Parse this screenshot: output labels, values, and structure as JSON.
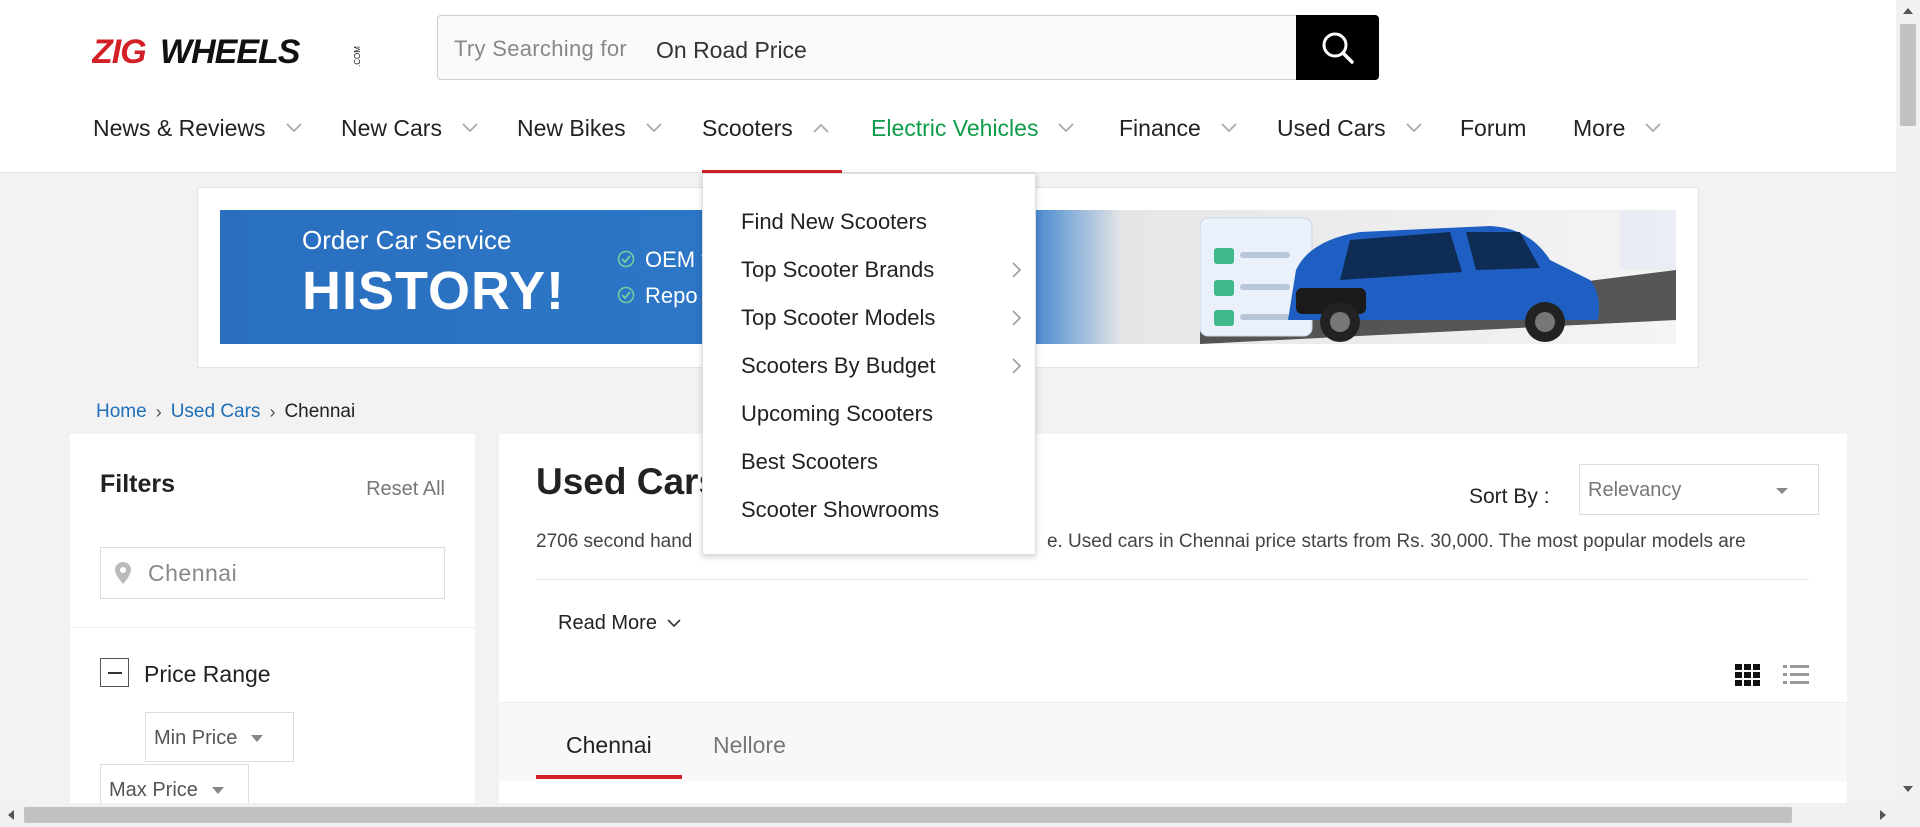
{
  "brand": {
    "logo_text": "ZIGWHEELS",
    "logo_suffix": ".COM",
    "red": "#d31f26",
    "green": "#0c9c4a",
    "link_blue": "#1e6fb8"
  },
  "search": {
    "prefix": "Try Searching for",
    "value": "On Road Price"
  },
  "nav": {
    "items": [
      {
        "label": "News & Reviews",
        "icon": "chevron-down-icon"
      },
      {
        "label": "New Cars",
        "icon": "chevron-down-icon"
      },
      {
        "label": "New Bikes",
        "icon": "chevron-down-icon"
      },
      {
        "label": "Scooters",
        "icon": "chevron-up-icon"
      },
      {
        "label": "Electric Vehicles",
        "icon": "chevron-down-icon"
      },
      {
        "label": "Finance",
        "icon": "chevron-down-icon"
      },
      {
        "label": "Used Cars",
        "icon": "chevron-down-icon"
      },
      {
        "label": "Forum"
      },
      {
        "label": "More",
        "icon": "chevron-down-icon"
      }
    ]
  },
  "scooters_menu": {
    "items": [
      {
        "label": "Find New Scooters"
      },
      {
        "label": "Top Scooter Brands",
        "icon": "chevron-right-icon"
      },
      {
        "label": "Top Scooter Models",
        "icon": "chevron-right-icon"
      },
      {
        "label": "Scooters By Budget",
        "icon": "chevron-right-icon"
      },
      {
        "label": "Upcoming Scooters"
      },
      {
        "label": "Best Scooters"
      },
      {
        "label": "Scooter Showrooms"
      }
    ]
  },
  "banner": {
    "line1": "Order Car Service",
    "line2": "HISTORY!",
    "bullet1": "OEM v",
    "bullet2": "Repo"
  },
  "breadcrumb": {
    "home": "Home",
    "used_cars": "Used Cars",
    "current": "Chennai"
  },
  "filters": {
    "title": "Filters",
    "reset": "Reset All",
    "location": "Chennai",
    "price_range": "Price Range",
    "min_price": "Min Price",
    "max_price": "Max Price"
  },
  "main": {
    "title": "Used Cars",
    "title_paren": ")",
    "sort_label": "Sort By :",
    "sort_value": "Relevancy",
    "desc_start": "2706 second hand",
    "desc_end": "e. Used cars in Chennai price starts from Rs. 30,000. The most popular models are",
    "read_more": "Read More",
    "tabs": [
      "Chennai",
      "Nellore"
    ]
  }
}
